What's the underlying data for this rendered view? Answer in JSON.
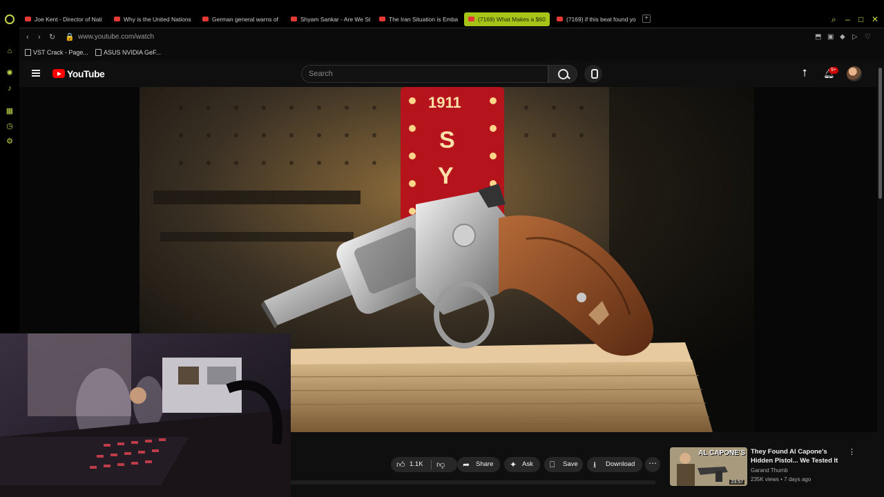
{
  "tabs": [
    {
      "title": "Joe Kent - Director of Nati",
      "active": false
    },
    {
      "title": "Why is the United Nations",
      "active": false
    },
    {
      "title": "German general warns of",
      "active": false
    },
    {
      "title": "Shyam Sankar - Are We St",
      "active": false
    },
    {
      "title": "The Iran Situation is Emba",
      "active": false
    },
    {
      "title": "(7169) What Makes a $60",
      "active": true
    },
    {
      "title": "(7169) if this beat found yo",
      "active": false
    }
  ],
  "address": {
    "url": "www.youtube.com/watch"
  },
  "bookmarks": [
    {
      "label": "VST Crack - Page..."
    },
    {
      "label": "ASUS NVIDIA GeF..."
    }
  ],
  "header": {
    "logo_text": "YouTube",
    "search_placeholder": "Search",
    "notification_count": "9+"
  },
  "video": {
    "sign_text_top": "1911",
    "sign_letters": [
      "S",
      "Y"
    ]
  },
  "actions": {
    "like_count": "1.1K",
    "share_label": "Share",
    "ask_label": "Ask",
    "save_label": "Save",
    "download_label": "Download"
  },
  "suggestion": {
    "thumb_title": "AL CAPONE'S",
    "duration": "23:57",
    "title": "They Found Al Capone's Hidden Pistol... We Tested It",
    "channel": "Garand Thumb",
    "meta": "235K views • 7 days ago"
  },
  "icons": {
    "accent": "#c9d84a",
    "yt_red": "#ff0000",
    "active_tab": "#a6c318"
  }
}
